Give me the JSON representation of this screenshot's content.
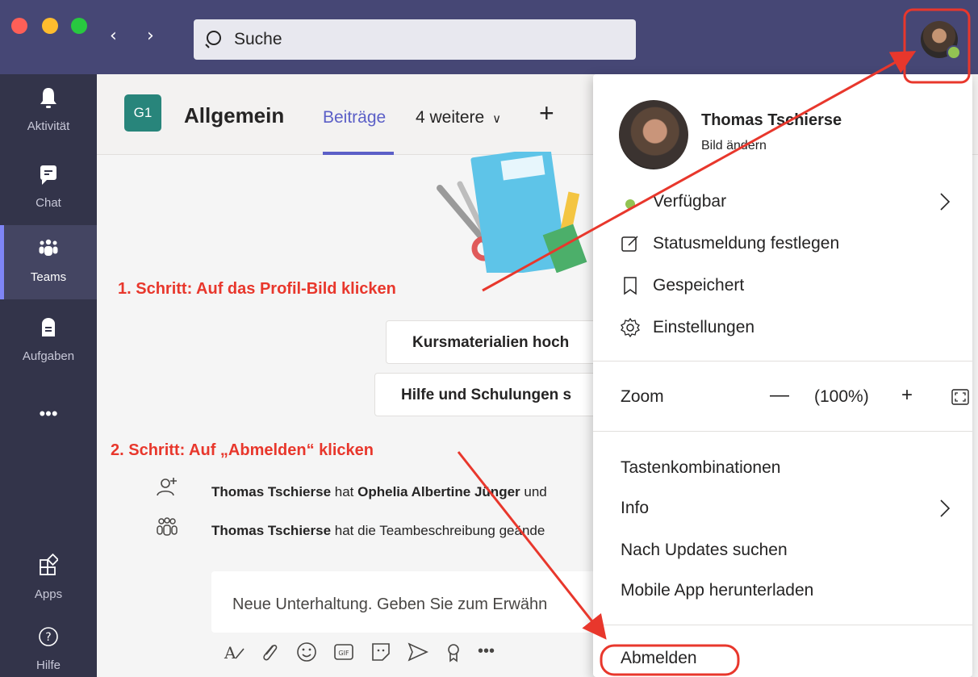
{
  "titlebar": {
    "search_placeholder": "Suche",
    "back_arrow": "‹",
    "forward_arrow": "›"
  },
  "rail": {
    "items": [
      {
        "label": "Aktivität",
        "icon": "bell-icon"
      },
      {
        "label": "Chat",
        "icon": "chat-icon"
      },
      {
        "label": "Teams",
        "icon": "teams-icon"
      },
      {
        "label": "Aufgaben",
        "icon": "assignments-icon"
      },
      {
        "label": "•••",
        "icon": "more-icon"
      },
      {
        "label": "Apps",
        "icon": "apps-icon"
      },
      {
        "label": "Hilfe",
        "icon": "help-icon"
      }
    ]
  },
  "channel": {
    "team_badge": "G1",
    "title": "Allgemein",
    "active_tab": "Beiträge",
    "more_tabs": "4 weitere",
    "add_tab": "+"
  },
  "content": {
    "button_upload": "Kursmaterialien hoch",
    "button_help": "Hilfe und Schulungen s",
    "activity_1_actor": "Thomas Tschierse",
    "activity_1_mid": " hat ",
    "activity_1_target": "Ophelia Albertine Jünger",
    "activity_1_end": " und",
    "activity_2_actor": "Thomas Tschierse",
    "activity_2_end": " hat die Teambeschreibung geände",
    "compose_placeholder": "Neue Unterhaltung. Geben Sie zum Erwähn"
  },
  "annotations": {
    "step1": "1. Schritt: Auf das Profil-Bild klicken",
    "step2": "2. Schritt: Auf „Abmelden“ klicken",
    "color": "#e8372c"
  },
  "menu": {
    "name": "Thomas Tschierse",
    "change_picture": "Bild ändern",
    "status": "Verfügbar",
    "set_status_message": "Statusmeldung festlegen",
    "saved": "Gespeichert",
    "settings": "Einstellungen",
    "zoom_label": "Zoom",
    "zoom_minus": "—",
    "zoom_value": "(100%)",
    "zoom_plus": "+",
    "shortcuts": "Tastenkombinationen",
    "info": "Info",
    "check_updates": "Nach Updates suchen",
    "mobile_app": "Mobile App herunterladen",
    "sign_out": "Abmelden"
  },
  "colors": {
    "titlebar": "#464775",
    "rail": "#33344a",
    "accent": "#5b5fc7",
    "available": "#92c353",
    "annotation": "#e8372c"
  }
}
